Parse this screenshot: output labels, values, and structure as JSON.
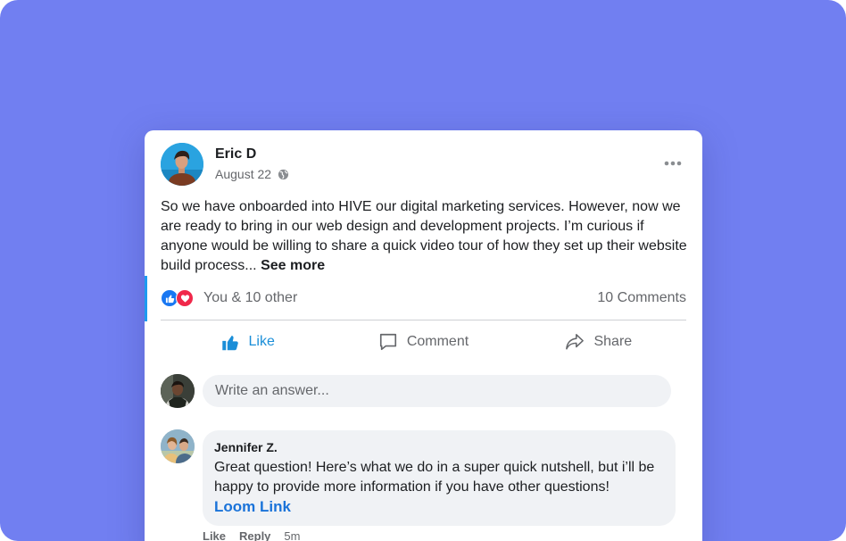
{
  "post": {
    "author": "Eric D",
    "date": "August 22",
    "text": "So we have onboarded into HIVE our digital marketing services. However, now we are ready to bring in our web design and development projects. I’m curious if anyone would be willing to share a quick video tour of how they set up their website build process...",
    "see_more": "See more",
    "reactions_text": "You & 10 other",
    "comments_count": "10 Comments"
  },
  "actions": {
    "like": "Like",
    "comment": "Comment",
    "share": "Share"
  },
  "composer": {
    "placeholder": "Write an answer..."
  },
  "comment": {
    "author": "Jennifer Z.",
    "text": "Great question! Here’s what we do in a super quick nutshell, but i’ll be happy to provide more information if you have other questions!",
    "link": "Loom Link",
    "like": "Like",
    "reply": "Reply",
    "time": "5m"
  },
  "icons": {
    "more": "more-dots-icon",
    "globe": "globe-icon",
    "like": "thumbs-up-icon",
    "comment": "comment-bubble-icon",
    "share": "share-arrow-icon",
    "reaction_like": "like-reaction-icon",
    "reaction_love": "love-reaction-icon"
  },
  "colors": {
    "background": "#717ff1",
    "accent": "#1a8ed8",
    "link": "#1a73d9",
    "love": "#f0284a"
  }
}
